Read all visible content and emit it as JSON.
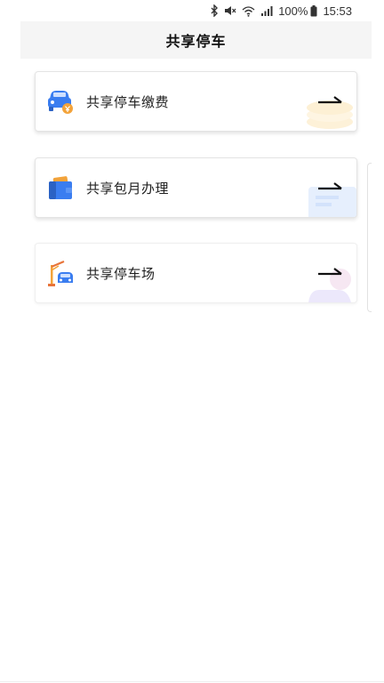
{
  "status_bar": {
    "battery_percent": "100%",
    "time": "15:53",
    "icons": [
      "bluetooth-icon",
      "mute-icon",
      "wifi-icon",
      "signal-icon",
      "battery-icon"
    ]
  },
  "header": {
    "title": "共享停车"
  },
  "menu": {
    "items": [
      {
        "label": "共享停车缴费",
        "icon": "car-payment-icon",
        "accent": "#3a7df0"
      },
      {
        "label": "共享包月办理",
        "icon": "wallet-icon",
        "accent": "#2f7ae5"
      },
      {
        "label": "共享停车场",
        "icon": "parking-lot-icon",
        "accent": "#f0a040"
      }
    ]
  },
  "colors": {
    "header_bg": "#f5f5f5",
    "text": "#222222",
    "primary_blue": "#3a7df0",
    "orange": "#f3a33a"
  }
}
